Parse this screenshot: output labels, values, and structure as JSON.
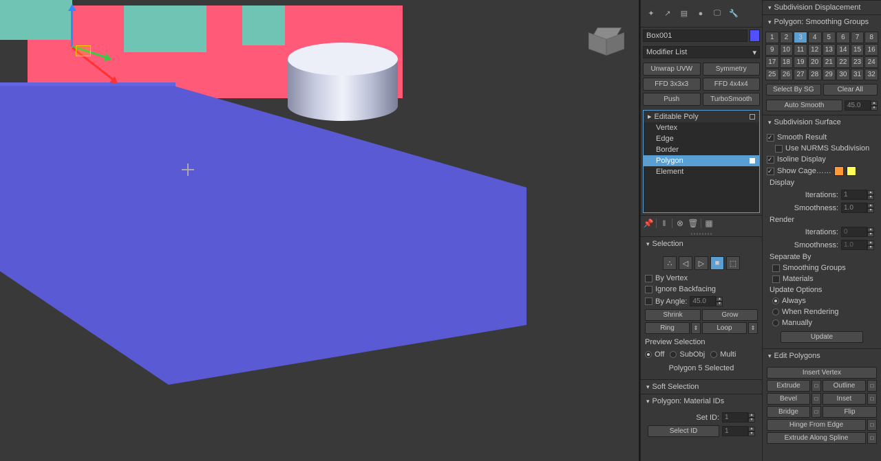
{
  "object_name": "Box001",
  "modifier_list_label": "Modifier List",
  "mod_buttons": {
    "unwrap": "Unwrap UVW",
    "symmetry": "Symmetry",
    "ffd3": "FFD 3x3x3",
    "ffd4": "FFD 4x4x4",
    "push": "Push",
    "turbo": "TurboSmooth"
  },
  "stack": {
    "root": "Editable Poly",
    "items": [
      "Vertex",
      "Edge",
      "Border",
      "Polygon",
      "Element"
    ],
    "selected": "Polygon"
  },
  "selection": {
    "title": "Selection",
    "by_vertex": "By Vertex",
    "ignore_backfacing": "Ignore Backfacing",
    "by_angle": "By Angle:",
    "by_angle_val": "45.0",
    "shrink": "Shrink",
    "grow": "Grow",
    "ring": "Ring",
    "loop": "Loop",
    "preview_sel": "Preview Selection",
    "off": "Off",
    "subobj": "SubObj",
    "multi": "Multi",
    "status": "Polygon 5 Selected"
  },
  "soft_selection": {
    "title": "Soft Selection"
  },
  "material_ids": {
    "title": "Polygon: Material IDs",
    "set_id": "Set ID:",
    "set_id_val": "1",
    "select_id": "Select ID",
    "select_id_val": "1"
  },
  "sub_disp": {
    "title": "Subdivision Displacement"
  },
  "smoothing_groups": {
    "title": "Polygon: Smoothing Groups",
    "active": 3,
    "select_by_sg": "Select By SG",
    "clear_all": "Clear All",
    "auto_smooth": "Auto Smooth",
    "auto_smooth_val": "45.0"
  },
  "sub_surf": {
    "title": "Subdivision Surface",
    "smooth_result": "Smooth Result",
    "use_nurms": "Use NURMS Subdivision",
    "isoline": "Isoline Display",
    "show_cage": "Show Cage……",
    "display": "Display",
    "render": "Render",
    "iterations": "Iterations:",
    "smoothness": "Smoothness:",
    "disp_iter": "1",
    "disp_smooth": "1.0",
    "rend_iter": "0",
    "rend_smooth": "1.0",
    "separate_by": "Separate By",
    "sep_sg": "Smoothing Groups",
    "sep_mat": "Materials",
    "update_opts": "Update Options",
    "always": "Always",
    "when_rendering": "When Rendering",
    "manually": "Manually",
    "update": "Update"
  },
  "edit_poly": {
    "title": "Edit Polygons",
    "insert_vertex": "Insert Vertex",
    "extrude": "Extrude",
    "outline": "Outline",
    "bevel": "Bevel",
    "inset": "Inset",
    "bridge": "Bridge",
    "flip": "Flip",
    "hinge": "Hinge From Edge",
    "extrude_spline": "Extrude Along Spline"
  }
}
